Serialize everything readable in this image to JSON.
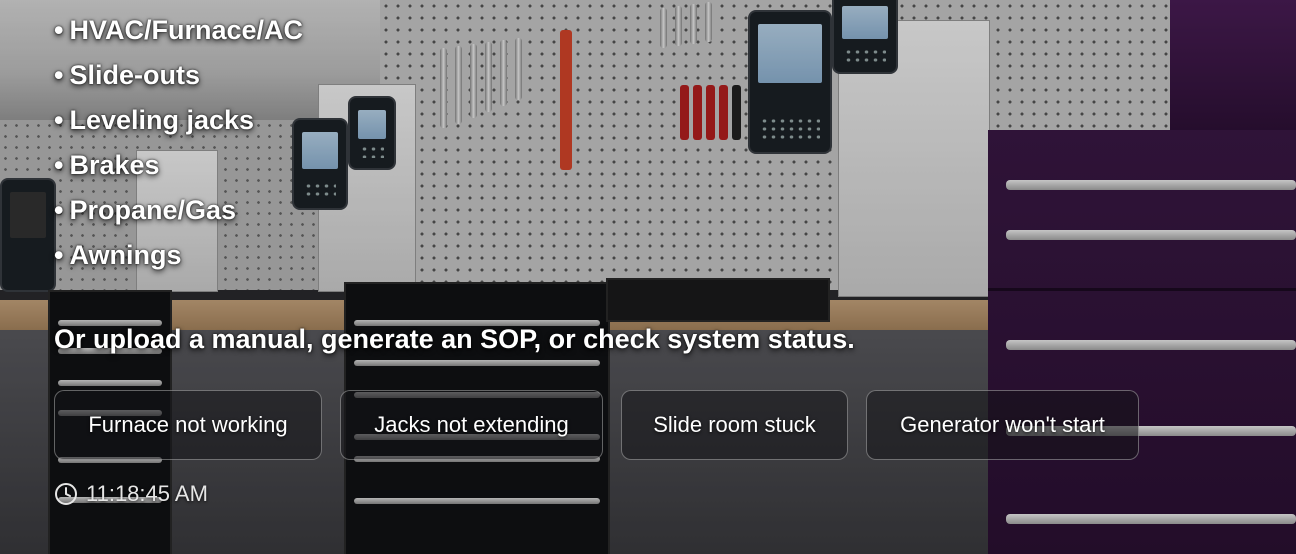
{
  "systems_list": [
    {
      "bullet": "•",
      "label": "HVAC/Furnace/AC"
    },
    {
      "bullet": "•",
      "label": "Slide-outs"
    },
    {
      "bullet": "•",
      "label": "Leveling jacks"
    },
    {
      "bullet": "•",
      "label": "Brakes"
    },
    {
      "bullet": "•",
      "label": "Propane/Gas"
    },
    {
      "bullet": "•",
      "label": "Awnings"
    }
  ],
  "prompt_text": "Or upload a manual, generate an SOP, or check system status.",
  "suggestions": [
    {
      "label": "Furnace not working"
    },
    {
      "label": "Jacks not extending"
    },
    {
      "label": "Slide room stuck"
    },
    {
      "label": "Generator won't start"
    }
  ],
  "clock": {
    "icon": "clock-icon",
    "time": "11:18:45 AM"
  },
  "colors": {
    "text": "#ffffff",
    "chip_border": "rgba(255,255,255,0.35)",
    "chip_bg": "rgba(20,20,24,0.55)"
  }
}
